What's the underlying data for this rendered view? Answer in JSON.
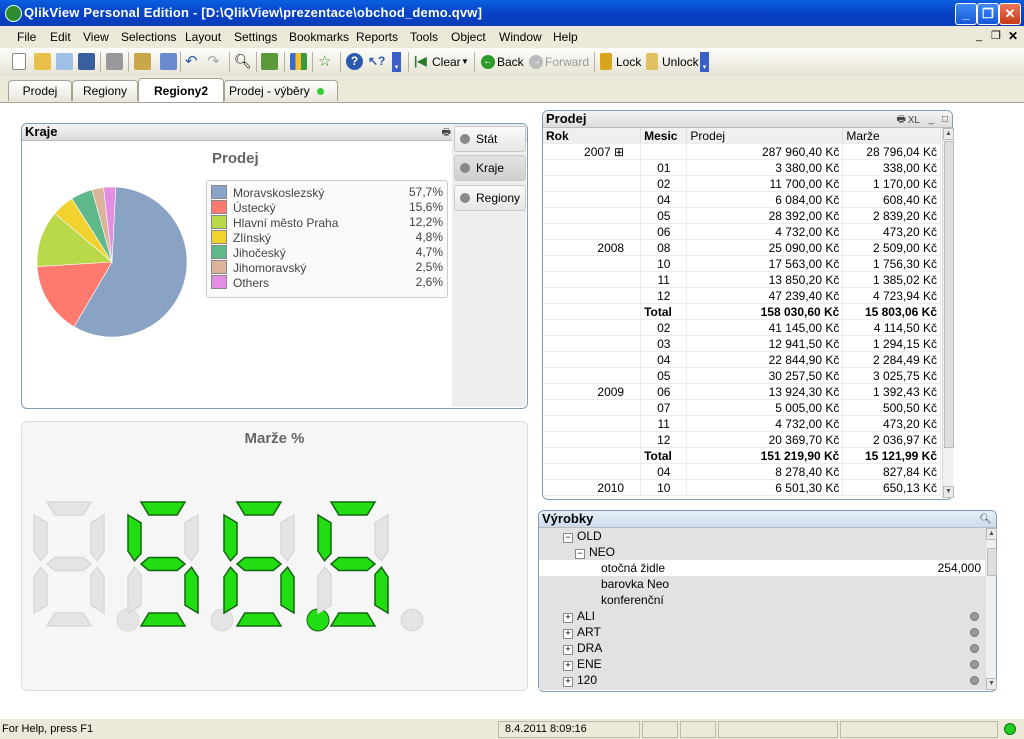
{
  "window": {
    "title": "QlikView Personal Edition - [D:\\QlikView\\prezentace\\obchod_demo.qvw]"
  },
  "menu": [
    "File",
    "Edit",
    "View",
    "Selections",
    "Layout",
    "Settings",
    "Bookmarks",
    "Reports",
    "Tools",
    "Object",
    "Window",
    "Help"
  ],
  "toolbar": {
    "clear": "Clear",
    "back": "Back",
    "forward": "Forward",
    "lock": "Lock",
    "unlock": "Unlock"
  },
  "tabs": [
    "Prodej",
    "Regiony",
    "Regiony2",
    "Prodej - výběry"
  ],
  "active_tab": "Regiony2",
  "kraje": {
    "caption": "Kraje",
    "xl": "XL",
    "chart_title": "Prodej",
    "side_buttons": [
      "Stát",
      "Kraje",
      "Regiony"
    ],
    "chart_data": {
      "type": "pie",
      "title": "Prodej",
      "slices": [
        {
          "name": "Moravskoslezský",
          "value": "57,7%",
          "pct": 57.7,
          "color": "#8aa2c4"
        },
        {
          "name": "Ústecký",
          "value": "15,6%",
          "pct": 15.6,
          "color": "#ff7a6e"
        },
        {
          "name": "Hlavní město Praha",
          "value": "12,2%",
          "pct": 12.2,
          "color": "#b9d84a"
        },
        {
          "name": "Zlínský",
          "value": "4,8%",
          "pct": 4.8,
          "color": "#f2d22e"
        },
        {
          "name": "Jihočeský",
          "value": "4,7%",
          "pct": 4.7,
          "color": "#5fb88a"
        },
        {
          "name": "Jihomoravský",
          "value": "2,5%",
          "pct": 2.5,
          "color": "#dcb49c"
        },
        {
          "name": "Others",
          "value": "2,6%",
          "pct": 2.6,
          "color": "#e38ee3"
        }
      ]
    }
  },
  "marze": {
    "title": "Marže %",
    "value": "56.5",
    "digit_color": "#22dd11"
  },
  "prodej": {
    "caption": "Prodej",
    "xl": "XL",
    "headers": [
      "Rok",
      "Mesic",
      "Prodej",
      "Marže"
    ],
    "rows": [
      {
        "rok": "2007",
        "mesic": "",
        "prodej": "287 960,40 Kč",
        "marze": "28 796,04 Kč",
        "type": "collapsed"
      },
      {
        "rok": "",
        "mesic": "01",
        "prodej": "3 380,00 Kč",
        "marze": "338,00 Kč"
      },
      {
        "rok": "",
        "mesic": "02",
        "prodej": "11 700,00 Kč",
        "marze": "1 170,00 Kč"
      },
      {
        "rok": "",
        "mesic": "04",
        "prodej": "6 084,00 Kč",
        "marze": "608,40 Kč"
      },
      {
        "rok": "",
        "mesic": "05",
        "prodej": "28 392,00 Kč",
        "marze": "2 839,20 Kč"
      },
      {
        "rok": "",
        "mesic": "06",
        "prodej": "4 732,00 Kč",
        "marze": "473,20 Kč"
      },
      {
        "rok": "2008",
        "mesic": "08",
        "prodej": "25 090,00 Kč",
        "marze": "2 509,00 Kč"
      },
      {
        "rok": "",
        "mesic": "10",
        "prodej": "17 563,00 Kč",
        "marze": "1 756,30 Kč"
      },
      {
        "rok": "",
        "mesic": "11",
        "prodej": "13 850,20 Kč",
        "marze": "1 385,02 Kč"
      },
      {
        "rok": "",
        "mesic": "12",
        "prodej": "47 239,40 Kč",
        "marze": "4 723,94 Kč"
      },
      {
        "rok": "",
        "mesic": "Total",
        "prodej": "158 030,60 Kč",
        "marze": "15 803,06 Kč",
        "type": "total"
      },
      {
        "rok": "",
        "mesic": "02",
        "prodej": "41 145,00 Kč",
        "marze": "4 114,50 Kč"
      },
      {
        "rok": "",
        "mesic": "03",
        "prodej": "12 941,50 Kč",
        "marze": "1 294,15 Kč"
      },
      {
        "rok": "",
        "mesic": "04",
        "prodej": "22 844,90 Kč",
        "marze": "2 284,49 Kč"
      },
      {
        "rok": "",
        "mesic": "05",
        "prodej": "30 257,50 Kč",
        "marze": "3 025,75 Kč"
      },
      {
        "rok": "2009",
        "mesic": "06",
        "prodej": "13 924,30 Kč",
        "marze": "1 392,43 Kč"
      },
      {
        "rok": "",
        "mesic": "07",
        "prodej": "5 005,00 Kč",
        "marze": "500,50 Kč"
      },
      {
        "rok": "",
        "mesic": "11",
        "prodej": "4 732,00 Kč",
        "marze": "473,20 Kč"
      },
      {
        "rok": "",
        "mesic": "12",
        "prodej": "20 369,70 Kč",
        "marze": "2 036,97 Kč"
      },
      {
        "rok": "",
        "mesic": "Total",
        "prodej": "151 219,90 Kč",
        "marze": "15 121,99 Kč",
        "type": "total"
      },
      {
        "rok": "",
        "mesic": "04",
        "prodej": "8 278,40 Kč",
        "marze": "827,84 Kč"
      },
      {
        "rok": "2010",
        "mesic": "10",
        "prodej": "6 501,30 Kč",
        "marze": "650,13 Kč"
      }
    ]
  },
  "vyrobky": {
    "caption": "Výrobky",
    "items": [
      {
        "label": "OLD",
        "level": 1,
        "toggle": "−",
        "value": ""
      },
      {
        "label": "NEO",
        "level": 2,
        "toggle": "−",
        "value": ""
      },
      {
        "label": "otočná židle",
        "level": 3,
        "toggle": "",
        "value": "254,000"
      },
      {
        "label": "barovka Neo",
        "level": 3,
        "toggle": "",
        "value": ""
      },
      {
        "label": "konferenční",
        "level": 3,
        "toggle": "",
        "value": ""
      },
      {
        "label": "ALI",
        "level": 1,
        "toggle": "+",
        "value": ""
      },
      {
        "label": "ART",
        "level": 1,
        "toggle": "+",
        "value": ""
      },
      {
        "label": "DRA",
        "level": 1,
        "toggle": "+",
        "value": ""
      },
      {
        "label": "ENE",
        "level": 1,
        "toggle": "+",
        "value": ""
      },
      {
        "label": "120",
        "level": 1,
        "toggle": "+",
        "value": ""
      }
    ]
  },
  "status": {
    "help": "For Help, press F1",
    "datetime": "8.4.2011 8:09:16"
  }
}
